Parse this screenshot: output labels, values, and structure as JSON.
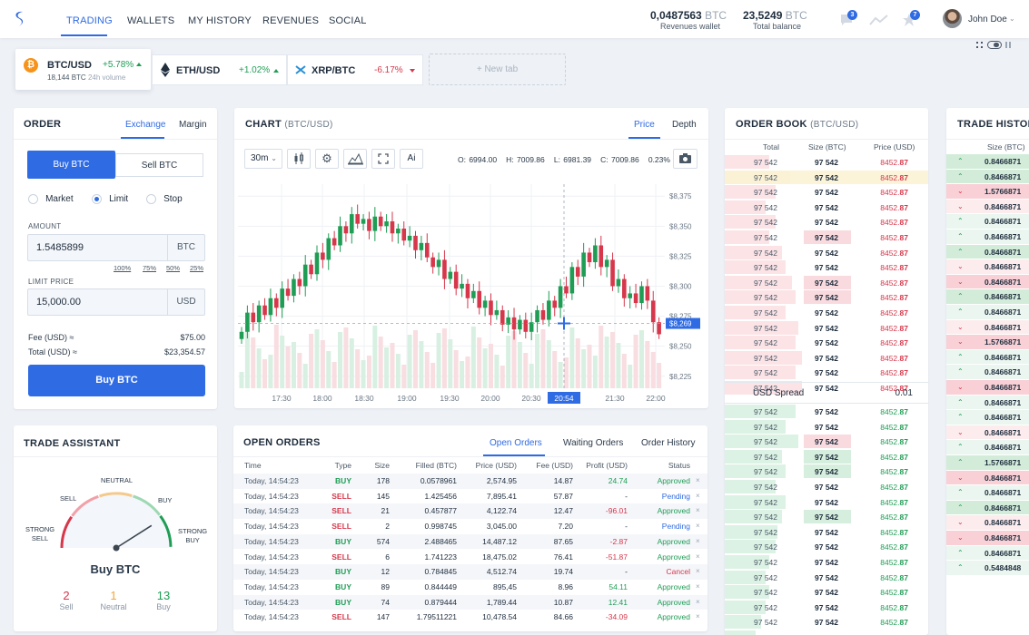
{
  "nav": {
    "items": [
      "TRADING",
      "WALLETS",
      "MY HISTORY",
      "REVENUES",
      "SOCIAL"
    ],
    "active": 0
  },
  "balances": {
    "revenues_value": "0,0487563",
    "revenues_unit": "BTC",
    "revenues_label": "Revenues wallet",
    "total_value": "23,5249",
    "total_unit": "BTC",
    "total_label": "Total balance"
  },
  "badges": {
    "messages": "3",
    "notifications": "7"
  },
  "user": {
    "name": "John Doe"
  },
  "tabs": [
    {
      "pair": "BTC/USD",
      "change": "+5.78%",
      "volume": "18,144 BTC",
      "volume_label": "24h volume",
      "dir": "up"
    },
    {
      "pair": "ETH/USD",
      "change": "+1.02%",
      "dir": "up"
    },
    {
      "pair": "XRP/BTC",
      "change": "-6.17%",
      "dir": "down"
    }
  ],
  "new_tab": "+ New tab",
  "order": {
    "title": "ORDER",
    "tab_exchange": "Exchange",
    "tab_margin": "Margin",
    "buy_tab": "Buy BTC",
    "sell_tab": "Sell BTC",
    "types": [
      "Market",
      "Limit",
      "Stop"
    ],
    "selected_type": "Limit",
    "amount_label": "AMOUNT",
    "amount_value": "1.5485899",
    "amount_unit": "BTC",
    "percents": [
      "100%",
      "75%",
      "50%",
      "25%"
    ],
    "limit_label": "LIMIT PRICE",
    "limit_value": "15,000.00",
    "limit_unit": "USD",
    "fee_label": "Fee (USD) ≈",
    "fee_value": "$75.00",
    "total_label": "Total (USD) ≈",
    "total_value": "$23,354.57",
    "submit": "Buy BTC"
  },
  "chart": {
    "title": "CHART",
    "pair": "(BTC/USD)",
    "tab_price": "Price",
    "tab_depth": "Depth",
    "interval": "30m",
    "ai": "Ai",
    "ohlc": {
      "o": "O: 6994.00",
      "h": "H: 7009.86",
      "l": "L: 6981.39",
      "c": "C: 7009.86",
      "pct": "0.23%"
    },
    "y_ticks": [
      "$8,375",
      "$8,350",
      "$8,325",
      "$8,300",
      "$8,275",
      "$8,250",
      "$8,225"
    ],
    "y_vals": [
      8375,
      8350,
      8325,
      8300,
      8275,
      8250,
      8225
    ],
    "x_ticks": [
      "17:30",
      "18:00",
      "18:30",
      "19:00",
      "19:30",
      "20:00",
      "20:30",
      "21:30",
      "22:00"
    ],
    "cursor_time": "20:54",
    "cursor_price": "$8,269"
  },
  "chart_data": {
    "type": "candlestick",
    "ylim": [
      8215,
      8385
    ],
    "closes": [
      8262,
      8278,
      8270,
      8284,
      8276,
      8290,
      8282,
      8298,
      8292,
      8306,
      8300,
      8318,
      8310,
      8328,
      8322,
      8340,
      8334,
      8350,
      8344,
      8360,
      8352,
      8356,
      8346,
      8358,
      8350,
      8354,
      8344,
      8348,
      8338,
      8342,
      8330,
      8336,
      8324,
      8316,
      8322,
      8306,
      8312,
      8298,
      8302,
      8290,
      8296,
      8282,
      8288,
      8276,
      8280,
      8268,
      8274,
      8264,
      8272,
      8262,
      8270,
      8280,
      8272,
      8288,
      8282,
      8300,
      8294,
      8316,
      8308,
      8328,
      8320,
      8334,
      8316,
      8322,
      8300,
      8306,
      8290,
      8294,
      8286,
      8300,
      8288,
      8270,
      8260
    ]
  },
  "assistant": {
    "title": "TRADE ASSISTANT",
    "labels": {
      "neutral": "NEUTRAL",
      "sell": "SELL",
      "buy": "BUY",
      "strong_sell_1": "STRONG",
      "strong_sell_2": "SELL",
      "strong_buy_1": "STRONG",
      "strong_buy_2": "BUY"
    },
    "verdict": "Buy BTC",
    "gauge_value": 0.82,
    "counts": [
      {
        "n": "2",
        "label": "Sell",
        "color": "#d6374b"
      },
      {
        "n": "1",
        "label": "Neutral",
        "color": "#f0a63a"
      },
      {
        "n": "13",
        "label": "Buy",
        "color": "#1f9d55"
      }
    ]
  },
  "open_orders": {
    "title": "OPEN ORDERS",
    "tabs": [
      "Open Orders",
      "Waiting Orders",
      "Order History"
    ],
    "columns": [
      "Time",
      "Type",
      "Size",
      "Filled (BTC)",
      "Price (USD)",
      "Fee (USD)",
      "Profit (USD)",
      "Status"
    ],
    "rows": [
      [
        "Today, 14:54:23",
        "BUY",
        "178",
        "0.0578961",
        "2,574.95",
        "14.87",
        "24.74",
        "Approved"
      ],
      [
        "Today, 14:54:23",
        "SELL",
        "145",
        "1.425456",
        "7,895.41",
        "57.87",
        "-",
        "Pending"
      ],
      [
        "Today, 14:54:23",
        "SELL",
        "21",
        "0.457877",
        "4,122.74",
        "12.47",
        "-96.01",
        "Approved"
      ],
      [
        "Today, 14:54:23",
        "SELL",
        "2",
        "0.998745",
        "3,045.00",
        "7.20",
        "-",
        "Pending"
      ],
      [
        "Today, 14:54:23",
        "BUY",
        "574",
        "2.488465",
        "14,487.12",
        "87.65",
        "-2.87",
        "Approved"
      ],
      [
        "Today, 14:54:23",
        "SELL",
        "6",
        "1.741223",
        "18,475.02",
        "76.41",
        "-51.87",
        "Approved"
      ],
      [
        "Today, 14:54:23",
        "BUY",
        "12",
        "0.784845",
        "4,512.74",
        "19.74",
        "-",
        "Cancel"
      ],
      [
        "Today, 14:54:23",
        "BUY",
        "89",
        "0.844449",
        "895,45",
        "8.96",
        "54.11",
        "Approved"
      ],
      [
        "Today, 14:54:23",
        "BUY",
        "74",
        "0.879444",
        "1,789.44",
        "10.87",
        "12.41",
        "Approved"
      ],
      [
        "Today, 14:54:23",
        "SELL",
        "147",
        "1.79511221",
        "10,478.54",
        "84.66",
        "-34.09",
        "Approved"
      ]
    ]
  },
  "order_book": {
    "title": "ORDER BOOK",
    "pair": "(BTC/USD)",
    "columns": [
      "Total",
      "Size (BTC)",
      "Price (USD)"
    ],
    "ask_total": "97 542",
    "ask_size": "97 542",
    "ask_price_main": "8452.",
    "ask_price_dec": "87",
    "spread_label": "USD Spread",
    "spread_value": "0.01",
    "ask_depth": [
      0.22,
      0.32,
      0.25,
      0.2,
      0.25,
      0.22,
      0.28,
      0.3,
      0.33,
      0.35,
      0.3,
      0.36,
      0.35,
      0.38,
      0.35,
      0.38
    ],
    "bid_depth": [
      0.35,
      0.3,
      0.36,
      0.28,
      0.3,
      0.25,
      0.3,
      0.28,
      0.26,
      0.25,
      0.22,
      0.2,
      0.22,
      0.2,
      0.18,
      0.15
    ]
  },
  "trade_history": {
    "title": "TRADE HISTOR",
    "column": "Size (BTC)",
    "rows": [
      {
        "v": "0.8466871",
        "d": "up"
      },
      {
        "v": "0.8466871",
        "d": "up"
      },
      {
        "v": "1.5766871",
        "d": "down"
      },
      {
        "v": "0.8466871",
        "d": "down"
      },
      {
        "v": "0.8466871",
        "d": "up"
      },
      {
        "v": "0.8466871",
        "d": "up"
      },
      {
        "v": "0.8466871",
        "d": "up"
      },
      {
        "v": "0.8466871",
        "d": "down"
      },
      {
        "v": "0.8466871",
        "d": "down"
      },
      {
        "v": "0.8466871",
        "d": "up"
      },
      {
        "v": "0.8466871",
        "d": "up"
      },
      {
        "v": "0.8466871",
        "d": "down"
      },
      {
        "v": "1.5766871",
        "d": "down"
      },
      {
        "v": "0.8466871",
        "d": "up"
      },
      {
        "v": "0.8466871",
        "d": "up"
      },
      {
        "v": "0.8466871",
        "d": "down"
      },
      {
        "v": "0.8466871",
        "d": "up"
      },
      {
        "v": "0.8466871",
        "d": "up"
      },
      {
        "v": "0.8466871",
        "d": "down"
      },
      {
        "v": "0.8466871",
        "d": "up"
      },
      {
        "v": "1.5766871",
        "d": "up"
      },
      {
        "v": "0.8466871",
        "d": "down"
      },
      {
        "v": "0.8466871",
        "d": "up"
      },
      {
        "v": "0.8466871",
        "d": "up"
      },
      {
        "v": "0.8466871",
        "d": "down"
      },
      {
        "v": "0.8466871",
        "d": "down"
      },
      {
        "v": "0.8466871",
        "d": "up"
      },
      {
        "v": "0.5484848",
        "d": "up"
      }
    ]
  },
  "colors": {
    "accent": "#2f6be3",
    "green": "#1f9d55",
    "red": "#d6374b"
  }
}
